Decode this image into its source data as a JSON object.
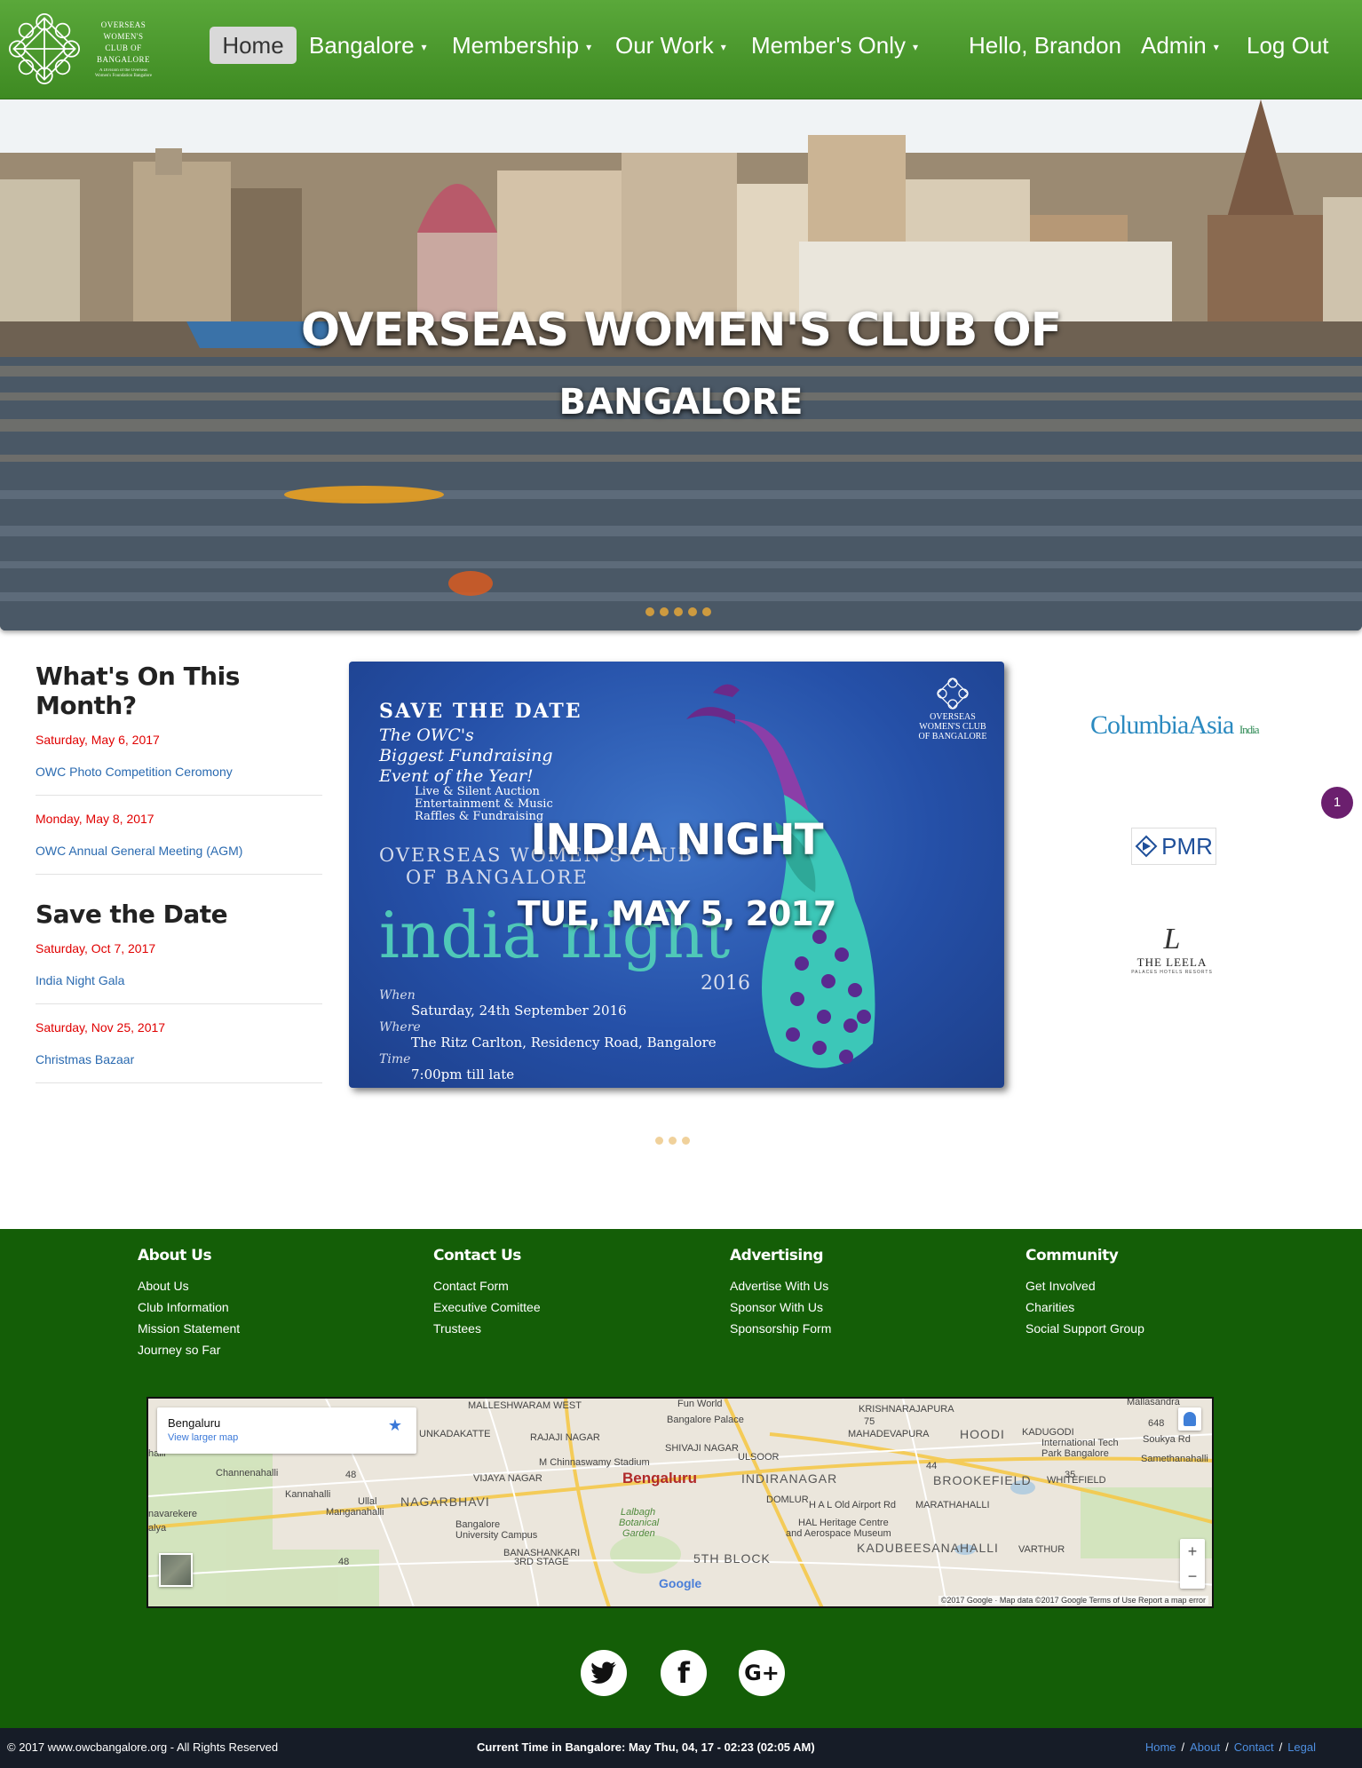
{
  "nav": {
    "logo_text": "OVERSEAS WOMEN'S CLUB OF BANGALORE",
    "logo_tagline": "A Division of the Overseas Women's Foundation Bangalore",
    "items": [
      {
        "label": "Home",
        "active": true
      },
      {
        "label": "Bangalore",
        "dropdown": true
      },
      {
        "label": "Membership",
        "dropdown": true
      },
      {
        "label": "Our Work",
        "dropdown": true
      },
      {
        "label": "Member's Only",
        "dropdown": true
      }
    ],
    "greeting": "Hello, Brandon",
    "admin": "Admin",
    "logout": "Log Out"
  },
  "hero": {
    "title_line1": "OVERSEAS WOMEN'S CLUB OF",
    "title_line2": "BANGALORE",
    "slide_count": 5
  },
  "events": {
    "month_heading": "What's On This Month?",
    "month_items": [
      {
        "date": "Saturday, May 6, 2017",
        "title": "OWC Photo Competition Ceromony"
      },
      {
        "date": "Monday, May 8, 2017",
        "title": "OWC Annual General Meeting (AGM)"
      }
    ],
    "save_heading": "Save the Date",
    "save_items": [
      {
        "date": "Saturday, Oct 7, 2017",
        "title": "India Night Gala"
      },
      {
        "date": "Saturday, Nov 25, 2017",
        "title": "Christmas Bazaar"
      }
    ]
  },
  "promo": {
    "save_the_date": "SAVE THE DATE",
    "biggest_1": "The OWC's",
    "biggest_2": "Biggest Fundraising",
    "biggest_3": "Event of the Year!",
    "auction_1": "Live & Silent Auction",
    "auction_2": "Entertainment & Music",
    "auction_3": "Raffles & Fundraising",
    "club_1": "OVERSEAS WOMEN'S CLUB",
    "club_2": "OF BANGALORE",
    "india_night_art": "india night",
    "year": "2016",
    "when_label": "When",
    "when_value": "Saturday, 24th September 2016",
    "where_label": "Where",
    "where_value": "The Ritz Carlton, Residency Road, Bangalore",
    "time_label": "Time",
    "time_value": "7:00pm till late",
    "overlay_title": "INDIA NIGHT",
    "overlay_date": "TUE, MAY 5, 2017",
    "logo_small": "OVERSEAS WOMEN'S CLUB OF BANGALORE",
    "slide_count": 3
  },
  "sponsors": {
    "columbia": "ColumbiaAsia",
    "columbia_india": "India",
    "pmr": "PMR",
    "leela_mark": "L",
    "leela_name": "THE LEELA",
    "leela_sub": "PALACES HOTELS RESORTS",
    "notification_count": "1"
  },
  "footer": {
    "columns": [
      {
        "heading": "About Us",
        "links": [
          "About Us",
          "Club Information",
          "Mission Statement",
          "Journey so Far"
        ]
      },
      {
        "heading": "Contact Us",
        "links": [
          "Contact Form",
          "Executive Comittee",
          "Trustees"
        ]
      },
      {
        "heading": "Advertising",
        "links": [
          "Advertise With Us",
          "Sponsor With Us",
          "Sponsorship Form"
        ]
      },
      {
        "heading": "Community",
        "links": [
          "Get Involved",
          "Charities",
          "Social Support Group"
        ]
      }
    ],
    "map": {
      "place": "Bengaluru",
      "larger_map": "View larger map",
      "labels": {
        "malleshwaram": "MALLESHWARAM WEST",
        "funworld": "Fun World",
        "palace": "Bangalore Palace",
        "krishnarajapura": "KRISHNARAJAPURA",
        "mallasandra": "Mallasandra",
        "kadugodi": "KADUGODI",
        "unkadakatte": "UNKADAKATTE",
        "rajajinagar": "RAJAJI NAGAR",
        "shivajinagar": "SHIVAJI NAGAR",
        "ulsoor": "ULSOOR",
        "mahadevapura": "MAHADEVAPURA",
        "hoodi": "HOODI",
        "techpark_1": "International Tech",
        "techpark_2": "Park Bangalore",
        "soukya": "Soukya Rd",
        "stadium": "M Chinnaswamy Stadium",
        "city": "Bengaluru",
        "indiranagar": "INDIRANAGAR",
        "brookefield": "BROOKEFIELD",
        "whitefield": "WHITEFIELD",
        "samethanahalli": "Samethanahalli",
        "channenahalli": "Channenahalli",
        "vijayanagar": "VIJAYA NAGAR",
        "kannahalli": "Kannahalli",
        "manganahalli": "Manganahalli",
        "nagarbhavi": "NAGARBHAVI",
        "domlur": "DOMLUR",
        "hal_airport": "H A L Old Airport Rd",
        "marathahalli": "MARATHAHALLI",
        "ullal": "Ullal",
        "university_1": "Bangalore",
        "university_2": "University Campus",
        "lalbagh_1": "Lalbagh",
        "lalbagh_2": "Botanical",
        "lalbagh_3": "Garden",
        "hal_heritage_1": "HAL Heritage Centre",
        "hal_heritage_2": "and Aerospace Museum",
        "kadubeesanahalli": "KADUBEESANAHALLI",
        "varthur": "VARTHUR",
        "banashankari_1": "BANASHANKARI",
        "banashankari_2": "3RD STAGE",
        "fifth_block": "5TH BLOCK",
        "navarekere": "navarekere",
        "halli": "halli",
        "alya": "alya",
        "road_75": "75",
        "road_648": "648",
        "road_48a": "48",
        "road_44": "44",
        "road_35": "35",
        "road_48b": "48"
      },
      "google": "Google",
      "attribution": "©2017 Google · Map data ©2017 Google   Terms of Use   Report a map error"
    },
    "copyright": "© 2017 www.owcbangalore.org - All Rights Reserved",
    "clock": "Current Time in Bangalore: May Thu, 04, 17 - 02:23 (02:05 AM)",
    "bottom_links": [
      "Home",
      "About",
      "Contact",
      "Legal"
    ]
  },
  "colors": {
    "nav_green": "#4a9a2c",
    "footer_green": "#145e07",
    "date_red": "#e00000",
    "link_blue": "#2a6ab0",
    "badge_purple": "#6b1f6e"
  }
}
